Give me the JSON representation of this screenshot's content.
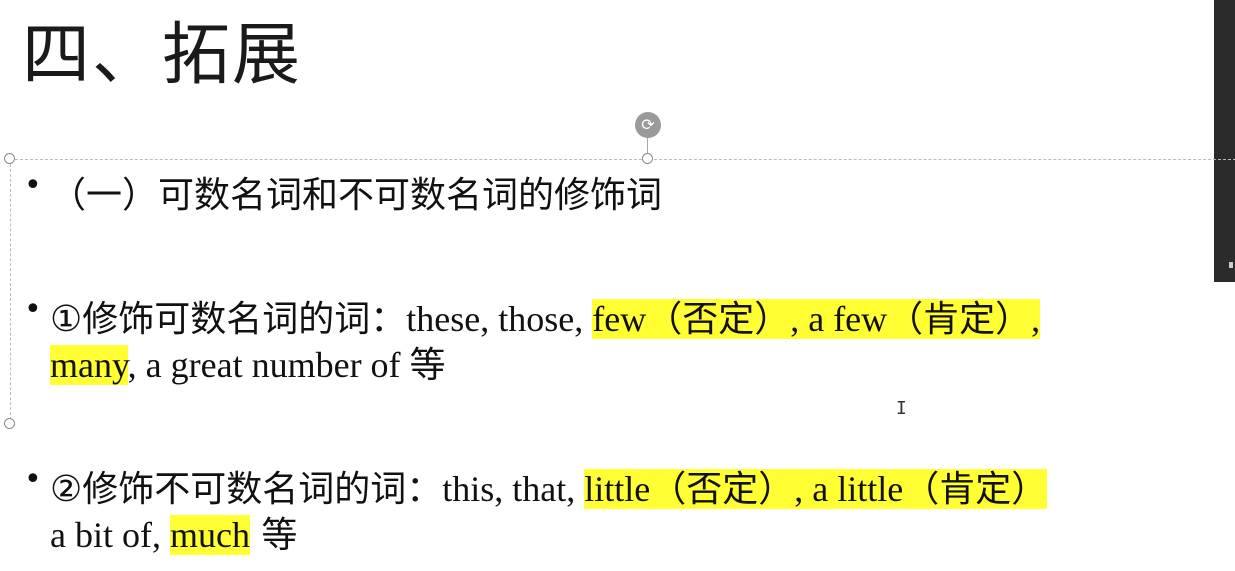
{
  "slide": {
    "title": "四、拓展",
    "section_heading": "（一）可数名词和不可数名词的修饰词",
    "bullets": [
      {
        "label": "①修饰可数名词的词：",
        "line1_plain": "these, those, ",
        "line1_hl1": "few（否定）",
        "line1_mid": ", a few（肯定）,",
        "line2_hl": "many",
        "line2_plain": ", a great number of ",
        "line2_end": "等"
      },
      {
        "label": "②修饰不可数名词的词：",
        "line1_plain": "this, that, ",
        "line1_hl1": "little（否定）",
        "line1_mid": ", a little（肯定）",
        "line2_plain": "a bit of, ",
        "line2_hl": "much",
        "line2_end": " 等"
      }
    ],
    "bullet_char": "•"
  },
  "colors": {
    "highlight": "#ffff33",
    "text": "#111111",
    "background": "#ffffff"
  },
  "icons": {
    "rotate_handle": "rotate-icon",
    "cursor": "text-cursor-icon"
  },
  "glyphs": {
    "rotate_glyph": "⟳",
    "cursor_glyph": "I"
  }
}
